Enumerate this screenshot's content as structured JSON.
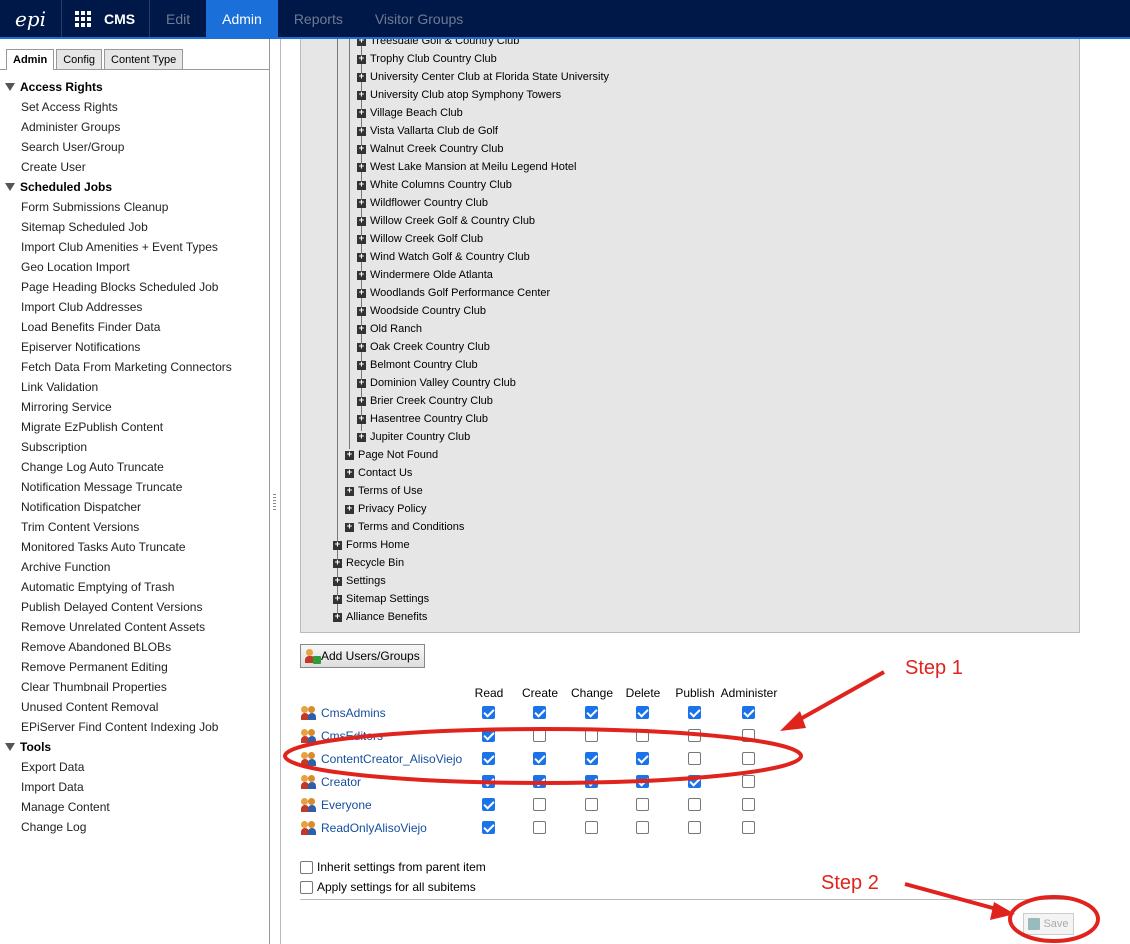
{
  "topbar": {
    "logo": "epi",
    "product": "CMS",
    "nav": [
      {
        "label": "Edit",
        "active": false
      },
      {
        "label": "Admin",
        "active": true
      },
      {
        "label": "Reports",
        "active": false
      },
      {
        "label": "Visitor Groups",
        "active": false
      }
    ]
  },
  "left": {
    "tabs": [
      {
        "label": "Admin",
        "active": true
      },
      {
        "label": "Config",
        "active": false
      },
      {
        "label": "Content Type",
        "active": false
      }
    ],
    "sections": [
      {
        "title": "Access Rights",
        "items": [
          "Set Access Rights",
          "Administer Groups",
          "Search User/Group",
          "Create User"
        ]
      },
      {
        "title": "Scheduled Jobs",
        "items": [
          "Form Submissions Cleanup",
          "Sitemap Scheduled Job",
          "Import Club Amenities + Event Types",
          "Geo Location Import",
          "Page Heading Blocks Scheduled Job",
          "Import Club Addresses",
          "Load Benefits Finder Data",
          "Episerver Notifications",
          "Fetch Data From Marketing Connectors",
          "Link Validation",
          "Mirroring Service",
          "Migrate EzPublish Content",
          "Subscription",
          "Change Log Auto Truncate",
          "Notification Message Truncate",
          "Notification Dispatcher",
          "Trim Content Versions",
          "Monitored Tasks Auto Truncate",
          "Archive Function",
          "Automatic Emptying of Trash",
          "Publish Delayed Content Versions",
          "Remove Unrelated Content Assets",
          "Remove Abandoned BLOBs",
          "Remove Permanent Editing",
          "Clear Thumbnail Properties",
          "Unused Content Removal",
          "EPiServer Find Content Indexing Job"
        ]
      },
      {
        "title": "Tools",
        "items": [
          "Export Data",
          "Import Data",
          "Manage Content",
          "Change Log"
        ]
      }
    ]
  },
  "tree": {
    "level3": [
      "Treesdale Golf & Country Club",
      "Trophy Club Country Club",
      "University Center Club at Florida State University",
      "University Club atop Symphony Towers",
      "Village Beach Club",
      "Vista Vallarta Club de Golf",
      "Walnut Creek Country Club",
      "West Lake Mansion at Meilu Legend Hotel",
      "White Columns Country Club",
      "Wildflower Country Club",
      "Willow Creek Golf & Country Club",
      "Willow Creek Golf Club",
      "Wind Watch Golf & Country Club",
      "Windermere Olde Atlanta",
      "Woodlands Golf Performance Center",
      "Woodside Country Club",
      "Old Ranch",
      "Oak Creek Country Club",
      "Belmont Country Club",
      "Dominion Valley Country Club",
      "Brier Creek Country Club",
      "Hasentree Country Club",
      "Jupiter Country Club"
    ],
    "level2": [
      "Page Not Found",
      "Contact Us",
      "Terms of Use",
      "Privacy Policy",
      "Terms and Conditions"
    ],
    "level1": [
      "Forms Home",
      "Recycle Bin",
      "Settings",
      "Sitemap Settings",
      "Alliance Benefits"
    ]
  },
  "add_button": "Add Users/Groups",
  "permissions": {
    "columns": [
      "Read",
      "Create",
      "Change",
      "Delete",
      "Publish",
      "Administer"
    ],
    "rows": [
      {
        "name": "CmsAdmins",
        "values": [
          true,
          true,
          true,
          true,
          true,
          true
        ]
      },
      {
        "name": "CmsEditors",
        "values": [
          true,
          false,
          false,
          false,
          false,
          false
        ]
      },
      {
        "name": "ContentCreator_AlisoViejo",
        "values": [
          true,
          true,
          true,
          true,
          false,
          false
        ]
      },
      {
        "name": "Creator",
        "values": [
          true,
          true,
          true,
          true,
          true,
          false
        ]
      },
      {
        "name": "Everyone",
        "values": [
          true,
          false,
          false,
          false,
          false,
          false
        ]
      },
      {
        "name": "ReadOnlyAlisoViejo",
        "values": [
          true,
          false,
          false,
          false,
          false,
          false
        ]
      }
    ]
  },
  "options": {
    "inherit": "Inherit settings from parent item",
    "apply_all": "Apply settings for all subitems"
  },
  "save_button": "Save",
  "annotations": {
    "step1": "Step 1",
    "step2": "Step 2",
    "color": "#e0231c"
  }
}
